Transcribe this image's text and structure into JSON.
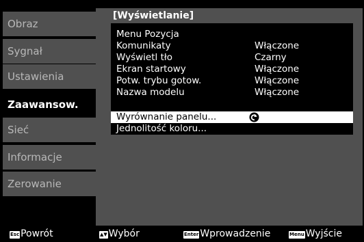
{
  "sidebar": {
    "items": [
      {
        "label": "Obraz",
        "active": false
      },
      {
        "label": "Sygnał",
        "active": false
      },
      {
        "label": "Ustawienia",
        "active": false
      },
      {
        "label": "Zaawansow.",
        "active": true
      },
      {
        "label": "Sieć",
        "active": false
      },
      {
        "label": "Informacje",
        "active": false
      },
      {
        "label": "Zerowanie",
        "active": false
      }
    ]
  },
  "panel": {
    "title": "[Wyświetlanie]",
    "rows": [
      {
        "label": "Menu Pozycja",
        "value": ""
      },
      {
        "label": "Komunikaty",
        "value": "Włączone"
      },
      {
        "label": "Wyświetl tło",
        "value": "Czarny"
      },
      {
        "label": "Ekran startowy",
        "value": "Włączone"
      },
      {
        "label": "Potw. trybu gotow.",
        "value": "Włączone"
      },
      {
        "label": "Nazwa modelu",
        "value": "Włączone"
      },
      {
        "label": "Wyrównanie panelu...",
        "value": "",
        "selected": true,
        "icon": "enter-return-icon"
      },
      {
        "label": "Jednolitość koloru...",
        "value": ""
      }
    ]
  },
  "footer": {
    "back": {
      "key": "Esc",
      "label": "Powrót"
    },
    "select": {
      "key": "▲▼",
      "label": "Wybór"
    },
    "enter": {
      "key": "Enter",
      "label": "Wprowadzenie"
    },
    "exit": {
      "key": "Menu",
      "label": "Wyjście"
    }
  },
  "colors": {
    "background": "#000000",
    "panel": "#505050",
    "sidebar_inactive_text": "#b8b8b8",
    "highlight": "#ffffff"
  }
}
